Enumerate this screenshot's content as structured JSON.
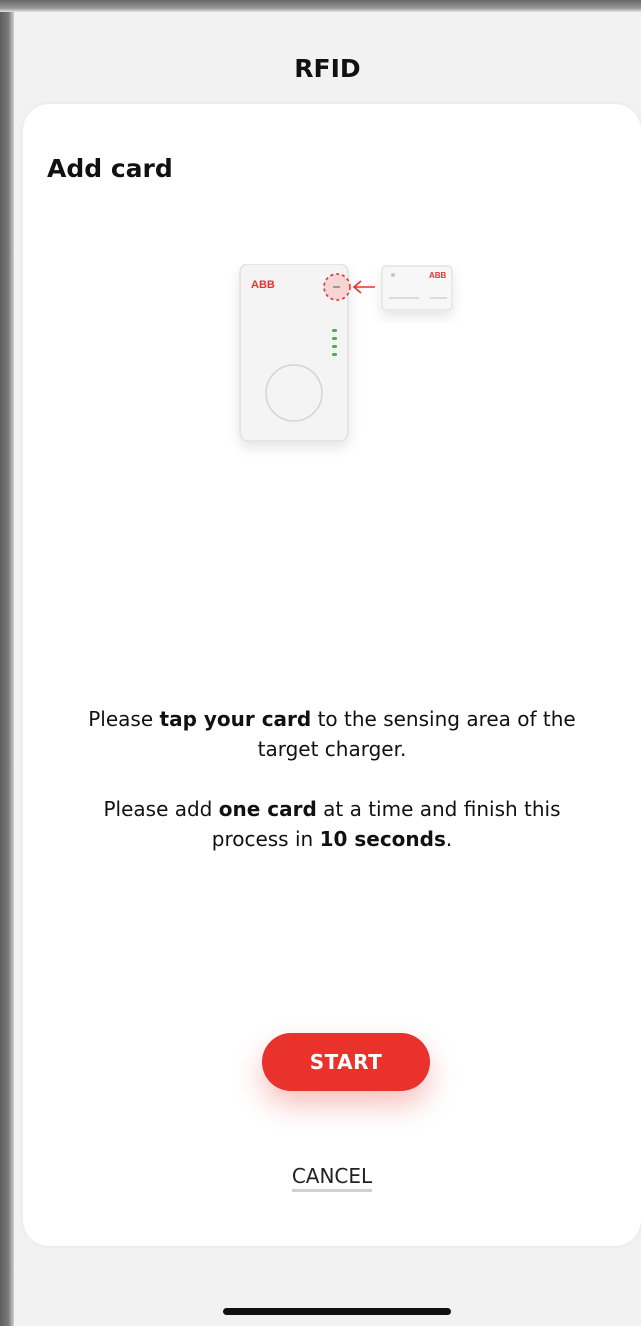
{
  "header": {
    "title": "RFID"
  },
  "card": {
    "title": "Add card"
  },
  "illustration": {
    "charger_logo": "ABB",
    "rfid_card_logo": "ABB",
    "led_count": 4
  },
  "instructions": {
    "line1_before": "Please ",
    "line1_bold": "tap your card",
    "line1_after": " to the sensing area of the target charger.",
    "line2_before": "Please add ",
    "line2_bold": "one card",
    "line2_middle": " at a time and finish this process in ",
    "line2_bold2": "10 seconds",
    "line2_after": "."
  },
  "actions": {
    "start_label": "START",
    "cancel_label": "CANCEL"
  },
  "colors": {
    "accent": "#e8322b",
    "led_green": "#4caf50",
    "background": "#f2f2f2",
    "surface": "#ffffff"
  }
}
